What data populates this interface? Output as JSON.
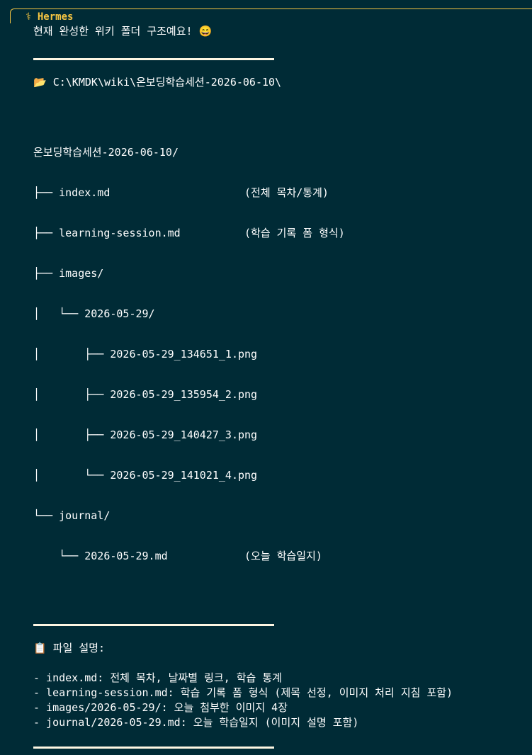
{
  "header": {
    "badge_icon": "⚕",
    "title": "Hermes"
  },
  "intro": "현재 완성한 위키 폴더 구조예요! 😄",
  "path_line": "📂 C:\\KMDK\\wiki\\온보딩학습세션-2026-06-10\\",
  "tree": [
    "온보딩학습세션-2026-06-10/",
    "├── index.md                     (전체 목차/통계)",
    "├── learning-session.md          (학습 기록 폼 형식)",
    "├── images/",
    "│   └── 2026-05-29/",
    "│       ├── 2026-05-29_134651_1.png",
    "│       ├── 2026-05-29_135954_2.png",
    "│       ├── 2026-05-29_140427_3.png",
    "│       └── 2026-05-29_141021_4.png",
    "└── journal/",
    "    └── 2026-05-29.md            (오늘 학습일지)"
  ],
  "files_heading": "📋 파일 설명:",
  "files": [
    "- index.md: 전체 목차, 날짜별 링크, 학습 통계",
    "- learning-session.md: 학습 기록 폼 형식 (제목 선정, 이미지 처리 지침 포함)",
    "- images/2026-05-29/: 오늘 첨부한 이미지 4장",
    "- journal/2026-05-29.md: 오늘 학습일지 (이미지 설명 포함)"
  ],
  "colors": {
    "background": "#002b36",
    "accent": "#f5c542",
    "text": "#ffffff"
  }
}
